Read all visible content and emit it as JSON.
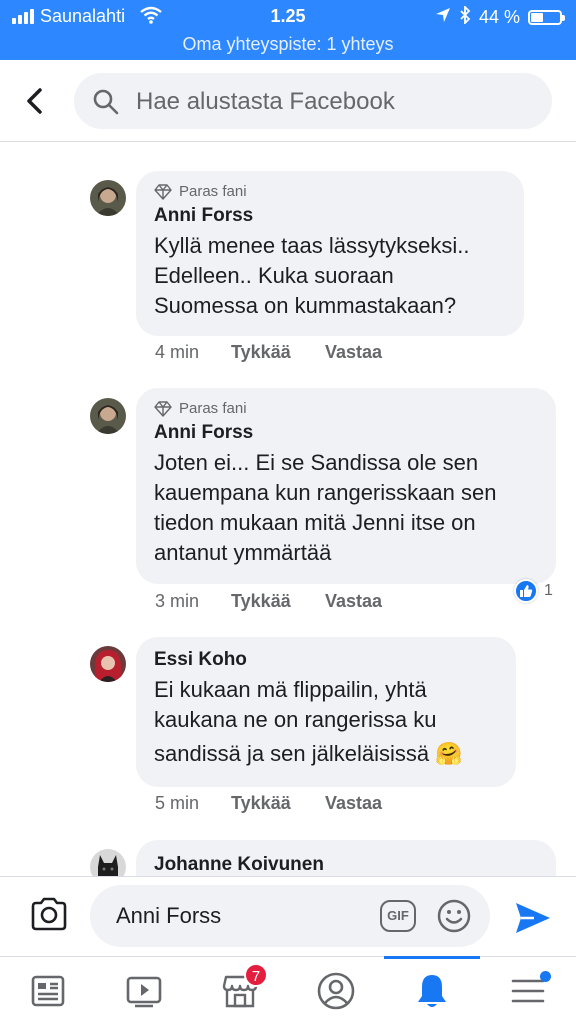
{
  "status_bar": {
    "carrier": "Saunalahti",
    "time": "1.25",
    "battery": "44 %",
    "battery_level": 0.44,
    "hotspot": "Oma yhteyspiste: 1 yhteys"
  },
  "search": {
    "placeholder": "Hae alustasta Facebook"
  },
  "comments": [
    {
      "badge": "Paras fani",
      "author": "Anni Forss",
      "lines": [
        "Kyllä menee taas lässytykseksi..",
        "Edelleen.. Kuka suoraan",
        "Suomessa on kummastakaan?"
      ],
      "time": "4 min",
      "like": "Tykkää",
      "reply": "Vastaa"
    },
    {
      "badge": "Paras fani",
      "author": "Anni Forss",
      "lines": [
        "Joten ei... Ei se Sandissa ole sen",
        "kauempana kun rangerisskaan sen",
        "tiedon mukaan mitä Jenni itse on",
        "antanut ymmärtää"
      ],
      "time": "3 min",
      "like": "Tykkää",
      "reply": "Vastaa",
      "reaction_count": "1"
    },
    {
      "author": "Essi Koho",
      "lines": [
        "Ei kukaan mä flippailin, yhtä",
        "kaukana ne on rangerissa ku",
        "sandissä ja sen jälkeläisissä 🤗"
      ],
      "time": "5 min",
      "like": "Tykkää",
      "reply": "Vastaa"
    },
    {
      "author": "Johanne Koivunen"
    }
  ],
  "composer": {
    "value": "Anni Forss",
    "gif_label": "GIF"
  },
  "tabbar": {
    "marketplace_badge": "7"
  },
  "colors": {
    "brand": "#1877f2",
    "status_bar": "#2d88ff",
    "bubble": "#f0f2f5",
    "badge_red": "#e41e3f"
  },
  "icons": [
    "signal-icon",
    "wifi-icon",
    "location-icon",
    "bluetooth-icon",
    "battery-icon",
    "back-icon",
    "search-icon",
    "diamond-icon",
    "like-reaction-icon",
    "camera-icon",
    "gif-icon",
    "emoji-icon",
    "send-icon",
    "news-feed-icon",
    "watch-icon",
    "marketplace-icon",
    "profile-icon",
    "notifications-icon",
    "menu-icon"
  ]
}
